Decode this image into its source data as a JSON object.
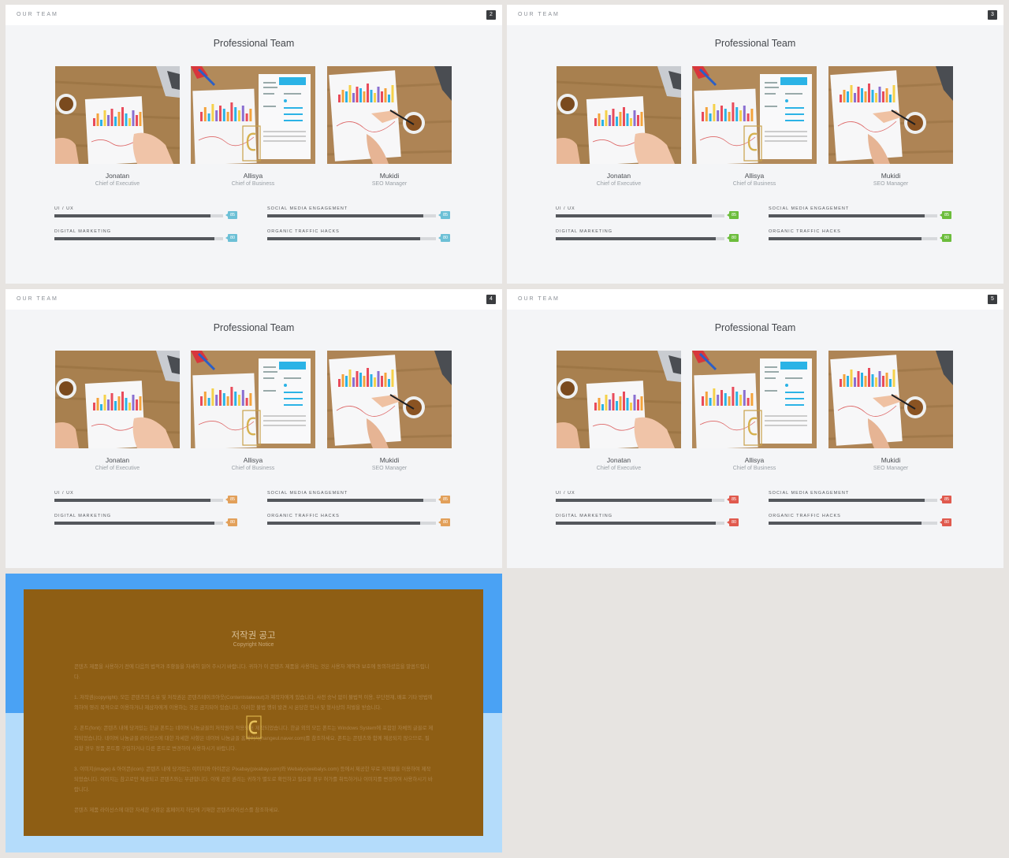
{
  "slides": [
    {
      "header": "OUR TEAM",
      "page": "2",
      "title": "Professional Team",
      "accent": "#6cc0d6"
    },
    {
      "header": "OUR TEAM",
      "page": "3",
      "title": "Professional Team",
      "accent": "#6cbd3c"
    },
    {
      "header": "OUR TEAM",
      "page": "4",
      "title": "Professional Team",
      "accent": "#e2a05a"
    },
    {
      "header": "OUR TEAM",
      "page": "5",
      "title": "Professional Team",
      "accent": "#e05a4e"
    }
  ],
  "members": [
    {
      "name": "Jonatan",
      "role": "Chief of Executive"
    },
    {
      "name": "Allisya",
      "role": "Chief of Business"
    },
    {
      "name": "Mukidi",
      "role": "SEO Manager"
    }
  ],
  "skills": [
    {
      "label": "UI / UX",
      "value": 85
    },
    {
      "label": "SOCIAL MEDIA ENGAGEMENT",
      "value": 85
    },
    {
      "label": "DIGITAL MARKETING",
      "value": 80
    },
    {
      "label": "ORGANIC TRAFFIC HACKS",
      "value": 80
    }
  ],
  "skill_fill_fraction": [
    0.925,
    0.925,
    0.95,
    0.905
  ],
  "notice": {
    "title": "저작권 공고",
    "subtitle": "Copyright Notice",
    "paragraphs": [
      "콘텐츠 제품을 사용하기 전에 다음의 법적과 조항들을 자세히 읽어 주시기 바랍니다. 귀하가 이 콘텐츠 제품을 사용하는 것은 사용자 계약과 보호에 동의하셨음을 말씀드립니다.",
      "1. 저작권(copyright): 모든 콘텐츠의 소유 및 저작권은 콘텐츠테이크아웃(Contentstakeout)과 제작자에게 있습니다. 사전 승낙 없이 불법적 이용, 무단전재, 배포 기타 방법에 의하여 영리 목적으로 이용하거나 제삼자에게 이용하는 것은 금지되어 있습니다. 이러한 불법 행위 발견 시 온당한 민사 및 형사상의 처벌을 받습니다.",
      "2. 폰트(font): 콘텐츠 내에 당겨있는 한글 폰트는 네이버 나눔글꼴의 저작원이 적용되어 제작되었습니다. 한글 외의 모든 폰트는 Windows System에 포함된 자체의 글꼴로 제작되었습니다. 네이버 나눔글꼴 라이선스에 대한 자세한 사항은 네이버 나눔글꼴 홈페이지(hangeul.naver.com)를 참조하세요. 폰트는 콘텐츠와 함께 제공되지 않으므로, 필요할 경우 정품 폰트를 구입하거나 다른 폰트로 변경하여 사용하시기 바랍니다.",
      "3. 이미지(image) & 아이콘(icon): 콘텐츠 내에 당겨있는 이미지와 아이콘은 Pixabay(pixabay.com)와 Webalys(webalys.com) 등에서 제공한 무료 저작물을 이용하여 제작되었습니다. 이미지는 참고로만 제공되고 콘텐츠와는 무관합니다. 이에 관한 권리는 귀하가 별도로 확인하고 필요할 경우 허가를 취득하거나 이미지를 변경하여 사용하시기 바랍니다.",
      "콘텐츠 제품 라이선스에 대한 자세한 사항은 홈페이지 하단에 기재한 콘텐츠라이선스를 참조하세요."
    ]
  }
}
